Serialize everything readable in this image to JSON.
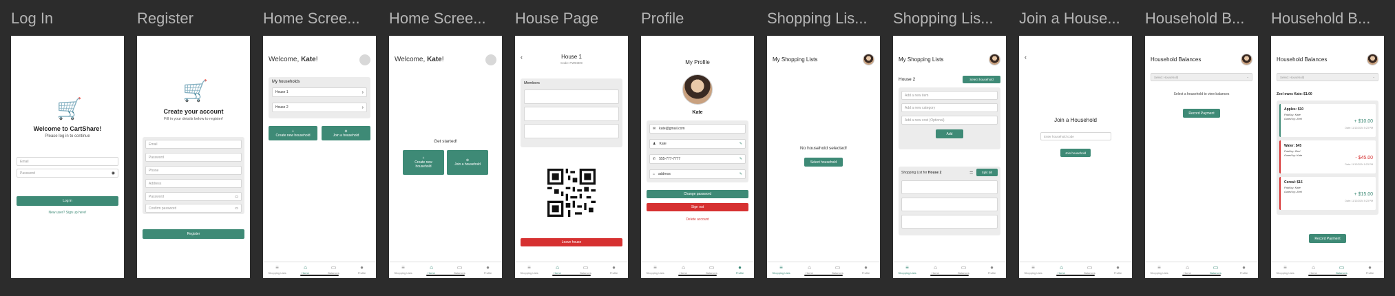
{
  "frames": [
    {
      "title": "Log In"
    },
    {
      "title": "Register"
    },
    {
      "title": "Home Scree..."
    },
    {
      "title": "Home Scree..."
    },
    {
      "title": "House Page"
    },
    {
      "title": "Profile"
    },
    {
      "title": "Shopping Lis..."
    },
    {
      "title": "Shopping Lis..."
    },
    {
      "title": "Join a House..."
    },
    {
      "title": "Household B..."
    },
    {
      "title": "Household B..."
    }
  ],
  "nav": {
    "shopping": "Shopping Lists",
    "home": "Home",
    "balances": "Balances",
    "profile": "Profile"
  },
  "login": {
    "title": "Welcome to CartShare!",
    "subtitle": "Please log in to continue",
    "email_placeholder": "Email",
    "password_placeholder": "Password",
    "login_button": "Log in",
    "signup_link": "New user? Sign up here!"
  },
  "register": {
    "title": "Create your account",
    "subtitle": "Fill in your details below to register!",
    "fields": [
      "Email",
      "Password",
      "Phone",
      "Address",
      "Password",
      "Confirm password"
    ],
    "button": "Register"
  },
  "home1": {
    "welcome": "Welcome, ",
    "name": "Kate",
    "exclaim": "!",
    "households_title": "My households",
    "households": [
      "House 1",
      "House 2"
    ],
    "create_button": "Create new household",
    "join_button": "Join a household"
  },
  "home2": {
    "welcome": "Welcome, ",
    "name": "Kate",
    "exclaim": "!",
    "get_started": "Get started!",
    "create_button": "Create new household",
    "join_button": "Join a household"
  },
  "house": {
    "title": "House 1",
    "code": "Code: FWD3D9",
    "members_label": "Members",
    "leave_button": "Leave house"
  },
  "profile": {
    "title": "My Profile",
    "name": "Kate",
    "email": "kate@gmail.com",
    "username": "Kate",
    "phone": "555-777-7777",
    "address": "address",
    "change_password": "Change password",
    "sign_out": "Sign out",
    "delete_account": "Delete account"
  },
  "shop1": {
    "title": "My Shopping Lists",
    "empty": "No household selected!",
    "select_button": "Select household"
  },
  "shop2": {
    "title": "My Shopping Lists",
    "house": "House 2",
    "select_button": "Select household",
    "item_placeholder": "Add a new item",
    "category_placeholder": "Add a new category",
    "cost_placeholder": "Add a new cost (Optional)",
    "add_button": "Add",
    "list_label": "Shopping List for ",
    "list_house": "House 2",
    "split_button": "Split bill"
  },
  "join": {
    "title": "Join a Household",
    "code_placeholder": "Enter household code",
    "join_button": "Join household"
  },
  "bal1": {
    "title": "Household Balances",
    "select_placeholder": "Select Household",
    "empty": "Select a household to view balances",
    "record_button": "Record Payment"
  },
  "bal2": {
    "title": "Household Balances",
    "select_placeholder": "Select Household",
    "owes": "Zeel owes Kate: $1.00",
    "entries": [
      {
        "item": "Apples: $10",
        "paid_by": "Paid by: Kate",
        "owed_by": "Owed by: Zeel",
        "amount": "+ $10.00",
        "date": "Date: 11/12/2024 5:23 PM",
        "positive": true
      },
      {
        "item": "Water: $45",
        "paid_by": "Paid by: Zeel",
        "owed_by": "Owed by: Kate",
        "amount": "- $45.00",
        "date": "Date: 11/12/2024 5:23 PM",
        "positive": false
      },
      {
        "item": "Cereal: $15",
        "paid_by": "Paid by: Kate",
        "owed_by": "Owed by: Zeel",
        "amount": "+ $15.00",
        "date": "Date: 11/12/2024 5:23 PM",
        "positive": true
      }
    ],
    "record_button": "Record Payment"
  },
  "colors": {
    "background": "#2c2c2c",
    "primary": "#3e8a76",
    "danger": "#d63131",
    "frame_title": "#b4b4b4"
  },
  "icons": [
    "cart-icon",
    "eye-icon",
    "chevron-right-icon",
    "chevron-left-icon",
    "pencil-icon",
    "mail-icon",
    "person-icon",
    "phone-icon",
    "home-icon",
    "list-icon",
    "wallet-icon",
    "profile-icon",
    "plus-icon",
    "sliders-icon",
    "qr-code-icon"
  ]
}
